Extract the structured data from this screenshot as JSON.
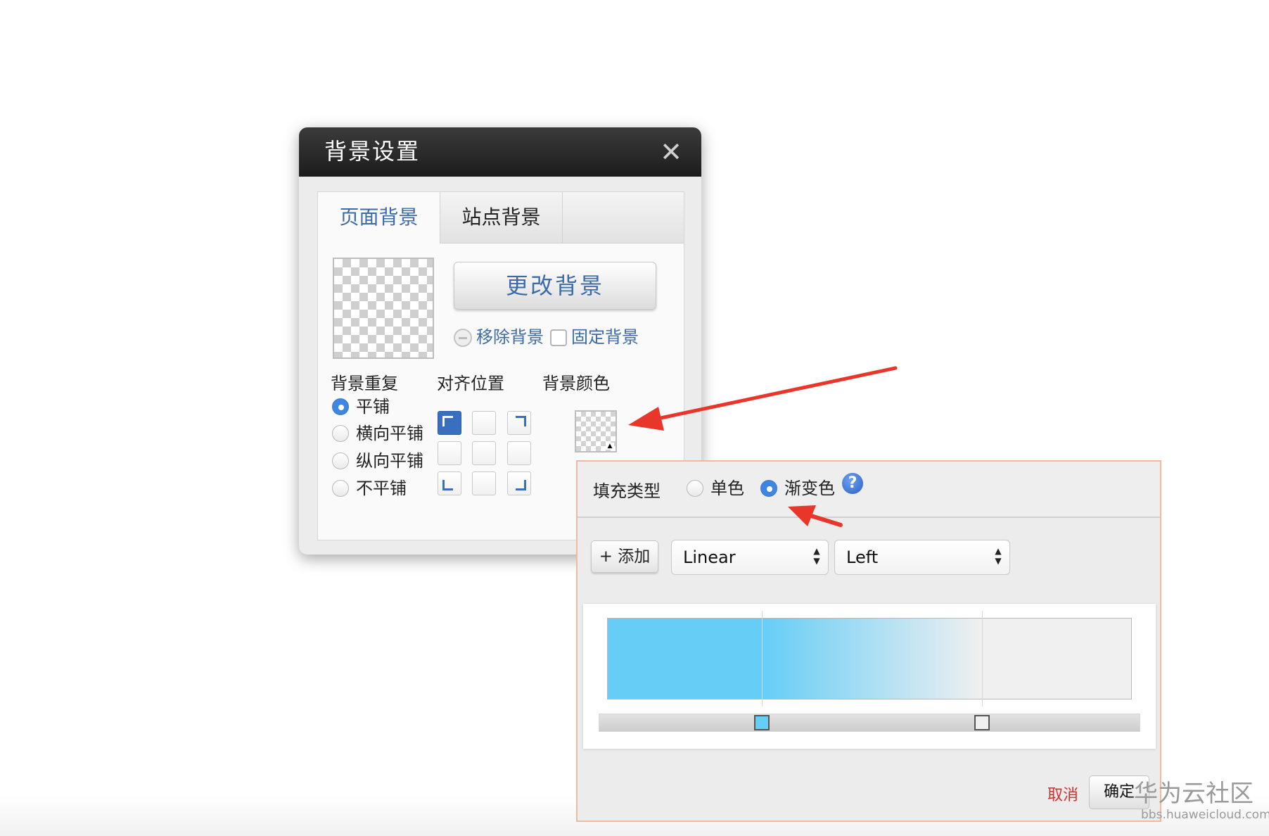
{
  "dialog": {
    "title": "背景设置",
    "close_icon": "close-icon",
    "tabs": [
      {
        "label": "页面背景",
        "active": true
      },
      {
        "label": "站点背景",
        "active": false
      }
    ],
    "change_bg_label": "更改背景",
    "remove_bg_label": "移除背景",
    "fixed_bg_label": "固定背景",
    "fixed_bg_checked": false,
    "sections": {
      "repeat": "背景重复",
      "align": "对齐位置",
      "color": "背景颜色"
    },
    "repeat_options": [
      {
        "label": "平铺",
        "checked": true
      },
      {
        "label": "横向平铺",
        "checked": false
      },
      {
        "label": "纵向平铺",
        "checked": false
      },
      {
        "label": "不平铺",
        "checked": false
      }
    ],
    "align_selected": "top-left"
  },
  "popup": {
    "fill_type_label": "填充类型",
    "fill_options": [
      {
        "label": "单色",
        "checked": false
      },
      {
        "label": "渐变色",
        "checked": true
      }
    ],
    "help_glyph": "?",
    "add_label": "+ 添加",
    "gradient_type": {
      "value": "Linear"
    },
    "direction": {
      "value": "Left"
    },
    "gradient_stops": [
      {
        "position_percent": 29.5,
        "color": "#66cdf6"
      },
      {
        "position_percent": 71.5,
        "color": "#f0f0f0"
      }
    ],
    "cancel_label": "取消",
    "ok_label": "确定"
  },
  "colors": {
    "accent_blue": "#3d6aa8",
    "radio_blue": "#3f86e3",
    "cancel_red": "#d0312d",
    "annotation_arrow": "#e8362b",
    "popup_border": "#f3b99b"
  },
  "watermark": {
    "main": "华为云社区",
    "sub": "bbs.huaweicloud.com"
  }
}
